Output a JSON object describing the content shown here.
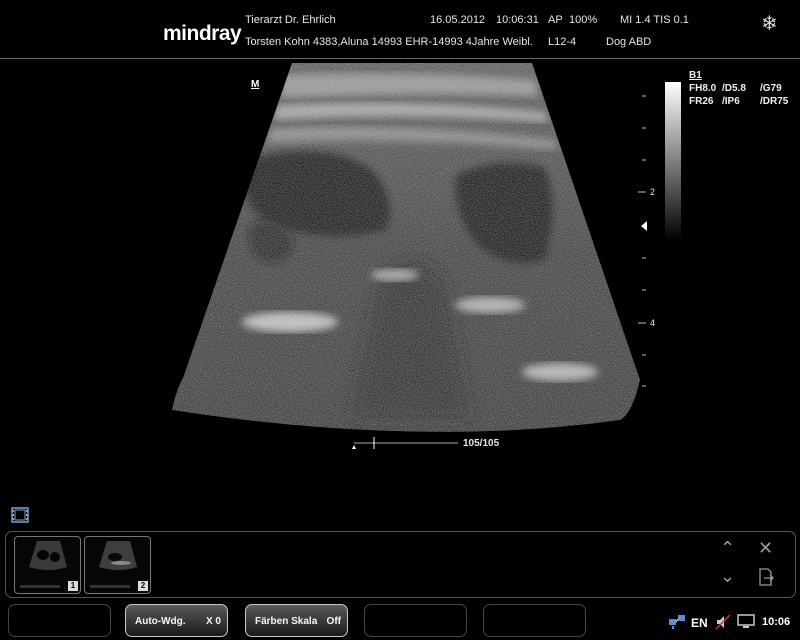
{
  "header": {
    "brand": "mindray",
    "clinic": "Tierarzt Dr. Ehrlich",
    "patient": "Torsten Kohn 4383,Aluna 14993 EHR-14993 4Jahre Weibl.",
    "date": "16.05.2012",
    "time": "10:06:31",
    "ap_label": "AP",
    "ap_value": "100%",
    "mi_tis": "MI 1.4 TIS 0.1",
    "probe": "L12-4",
    "exam": "Dog ABD",
    "freeze_icon": "snowflake-icon"
  },
  "image_area": {
    "mode_label": "M",
    "cine_counter": "105/105",
    "params": {
      "title": "B1",
      "fh": "FH8.0",
      "d": "/D5.8",
      "g": "/G79",
      "fr": "FR26",
      "ip": "/IP6",
      "dr": "/DR75"
    },
    "depth_ticks": [
      "2",
      "4"
    ],
    "colors": {
      "background": "#000000",
      "tissue": "#bfbfbf"
    }
  },
  "thumbnails": [
    {
      "number": "1"
    },
    {
      "number": "2"
    }
  ],
  "thumbnail_controls": [
    "collapse-up-icon",
    "close-icon",
    "expand-down-icon",
    "export-icon"
  ],
  "softkeys": [
    {
      "label": "",
      "value": ""
    },
    {
      "label": "Auto-Wdg.",
      "value": "X 0"
    },
    {
      "label": "Färben Skala",
      "value": "Off"
    },
    {
      "label": "",
      "value": ""
    },
    {
      "label": "",
      "value": ""
    }
  ],
  "tray": {
    "language": "EN",
    "clock": "10:06"
  }
}
